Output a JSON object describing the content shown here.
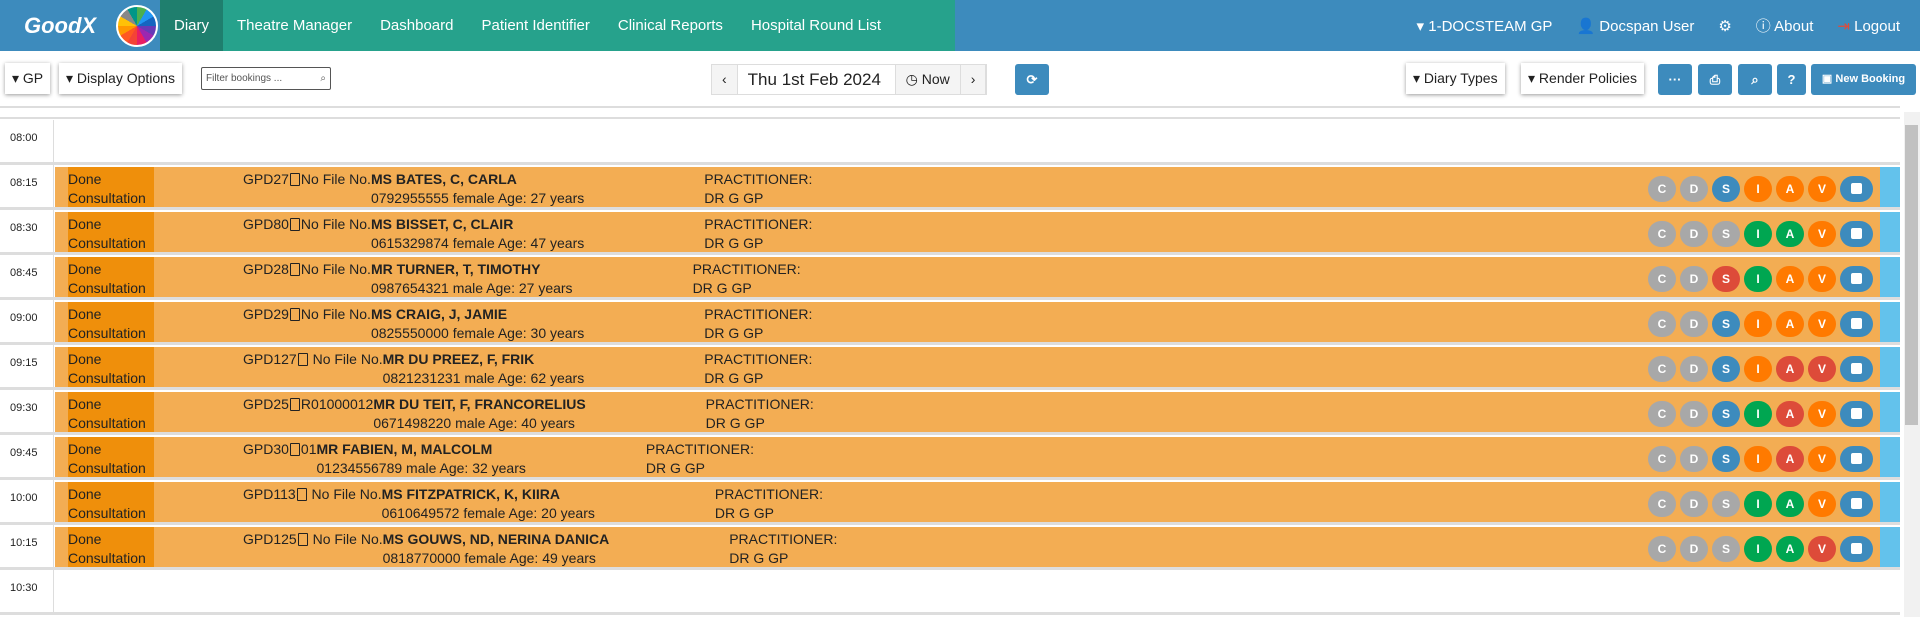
{
  "nav": {
    "logo": "GoodX",
    "menu": [
      "Diary",
      "Theatre Manager",
      "Dashboard",
      "Patient Identifier",
      "Clinical Reports",
      "Hospital Round List"
    ],
    "practice": "1-DOCSTEAM GP",
    "user": "Docspan User",
    "about": "About",
    "logout": "Logout"
  },
  "toolbar": {
    "gp": "GP",
    "display_options": "Display Options",
    "filter_placeholder": "Filter bookings ...",
    "date": "Thu 1st Feb 2024",
    "now": "Now",
    "diary_types": "Diary Types",
    "render_policies": "Render Policies",
    "more": "···",
    "help": "?",
    "new_booking": "New Booking"
  },
  "colors": {
    "grey": "#a8a8a8",
    "blue": "#3d8bbd",
    "orange": "#ff7a00",
    "green": "#00a651",
    "red": "#dd4b39"
  },
  "slots": {
    "first": "08:00",
    "last": "10:30"
  },
  "bookings": [
    {
      "time": "08:15",
      "status1": "Done",
      "status2": "Consultation",
      "id": "GPD27",
      "file": "No File No.",
      "name": "MS BATES, C, CARLA",
      "details": "0792955555 female Age: 27 years",
      "prac1": "PRACTITIONER:",
      "prac2": "DR G GP",
      "badges": [
        "grey",
        "grey",
        "blue",
        "orange",
        "orange",
        "orange"
      ]
    },
    {
      "time": "08:30",
      "status1": "Done",
      "status2": "Consultation",
      "id": "GPD80",
      "file": "No File No.",
      "name": "MS BISSET, C, CLAIR",
      "details": "0615329874 female Age: 47 years",
      "prac1": "PRACTITIONER:",
      "prac2": "DR G GP",
      "badges": [
        "grey",
        "grey",
        "grey",
        "green",
        "green",
        "orange"
      ]
    },
    {
      "time": "08:45",
      "status1": "Done",
      "status2": "Consultation",
      "id": "GPD28",
      "file": "No File No.",
      "name": "MR TURNER, T, TIMOTHY",
      "details": "0987654321 male Age: 27 years",
      "prac1": "PRACTITIONER:",
      "prac2": "DR G GP",
      "badges": [
        "grey",
        "grey",
        "red",
        "green",
        "orange",
        "orange"
      ]
    },
    {
      "time": "09:00",
      "status1": "Done",
      "status2": "Consultation",
      "id": "GPD29",
      "file": "No File No.",
      "name": "MS CRAIG, J, JAMIE",
      "details": "0825550000 female Age: 30 years",
      "prac1": "PRACTITIONER:",
      "prac2": "DR G GP",
      "badges": [
        "grey",
        "grey",
        "blue",
        "orange",
        "orange",
        "orange"
      ]
    },
    {
      "time": "09:15",
      "status1": "Done",
      "status2": "Consultation",
      "id": "GPD127",
      "file": " No File No.",
      "name": "MR DU PREEZ, F, FRIK",
      "details": "0821231231 male Age: 62 years",
      "prac1": "PRACTITIONER:",
      "prac2": "DR G GP",
      "badges": [
        "grey",
        "grey",
        "blue",
        "orange",
        "red",
        "red"
      ]
    },
    {
      "time": "09:30",
      "status1": "Done",
      "status2": "Consultation",
      "id": "GPD25",
      "file": "R01000012",
      "name": "MR DU TEIT, F, FRANCORELIUS",
      "details": "0671498220 male Age: 40 years",
      "prac1": "PRACTITIONER:",
      "prac2": "DR G GP",
      "badges": [
        "grey",
        "grey",
        "blue",
        "green",
        "red",
        "orange"
      ]
    },
    {
      "time": "09:45",
      "status1": "Done",
      "status2": "Consultation",
      "id": "GPD30",
      "file": "01",
      "name": "MR FABIEN, M, MALCOLM",
      "details": "01234556789 male Age: 32 years",
      "prac1": "PRACTITIONER:",
      "prac2": "DR G GP",
      "badges": [
        "grey",
        "grey",
        "blue",
        "orange",
        "red",
        "orange"
      ]
    },
    {
      "time": "10:00",
      "status1": "Done",
      "status2": "Consultation",
      "id": "GPD113",
      "file": " No File No.",
      "name": "MS FITZPATRICK, K, KIIRA",
      "details": "0610649572 female Age: 20 years",
      "prac1": "PRACTITIONER:",
      "prac2": "DR G GP",
      "badges": [
        "grey",
        "grey",
        "grey",
        "green",
        "green",
        "orange"
      ]
    },
    {
      "time": "10:15",
      "status1": "Done",
      "status2": "Consultation",
      "id": "GPD125",
      "file": " No File No.",
      "name": "MS GOUWS, ND, NERINA DANICA",
      "details": "0818770000 female Age: 49 years",
      "prac1": "PRACTITIONER:",
      "prac2": "DR G GP",
      "badges": [
        "grey",
        "grey",
        "grey",
        "green",
        "green",
        "red"
      ]
    }
  ],
  "badge_letters": [
    "C",
    "D",
    "S",
    "I",
    "A",
    "V"
  ]
}
